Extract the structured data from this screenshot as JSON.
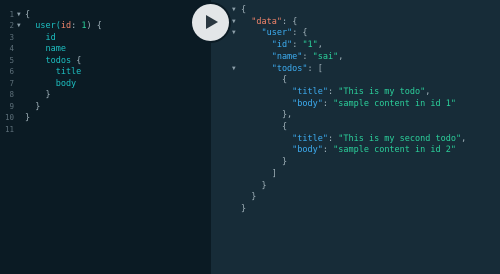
{
  "query_editor": {
    "lines": [
      {
        "num": "1",
        "fold": "▼",
        "parts": [
          {
            "t": "{",
            "c": "punc"
          }
        ]
      },
      {
        "num": "2",
        "fold": "▼",
        "parts": [
          {
            "t": "  user(",
            "c": "field"
          },
          {
            "t": "id",
            "c": "arg"
          },
          {
            "t": ": ",
            "c": "punc"
          },
          {
            "t": "1",
            "c": "num"
          },
          {
            "t": ") {",
            "c": "punc"
          }
        ]
      },
      {
        "num": "3",
        "fold": "",
        "parts": [
          {
            "t": "    id",
            "c": "field"
          }
        ]
      },
      {
        "num": "4",
        "fold": "",
        "parts": [
          {
            "t": "    name",
            "c": "field"
          }
        ]
      },
      {
        "num": "5",
        "fold": "",
        "parts": [
          {
            "t": "    todos ",
            "c": "field"
          },
          {
            "t": "{",
            "c": "punc"
          }
        ]
      },
      {
        "num": "6",
        "fold": "",
        "parts": [
          {
            "t": "      title",
            "c": "field"
          }
        ]
      },
      {
        "num": "7",
        "fold": "",
        "parts": [
          {
            "t": "      body",
            "c": "field"
          }
        ]
      },
      {
        "num": "8",
        "fold": "",
        "parts": [
          {
            "t": "    }",
            "c": "punc"
          }
        ]
      },
      {
        "num": "9",
        "fold": "",
        "parts": [
          {
            "t": "  }",
            "c": "punc"
          }
        ]
      },
      {
        "num": "10",
        "fold": "",
        "parts": [
          {
            "t": "}",
            "c": "punc"
          }
        ]
      },
      {
        "num": "11",
        "fold": "",
        "parts": []
      }
    ]
  },
  "run_button": {
    "icon": "play-icon"
  },
  "result_viewer": {
    "lines": [
      {
        "fold": "▼",
        "parts": [
          {
            "t": "{",
            "c": "punc"
          }
        ]
      },
      {
        "fold": "▼",
        "parts": [
          {
            "t": "  \"data\"",
            "c": "key-top"
          },
          {
            "t": ": {",
            "c": "punc"
          }
        ]
      },
      {
        "fold": "▼",
        "parts": [
          {
            "t": "    \"user\"",
            "c": "key"
          },
          {
            "t": ": {",
            "c": "punc"
          }
        ]
      },
      {
        "fold": "",
        "parts": [
          {
            "t": "      \"id\"",
            "c": "key"
          },
          {
            "t": ": ",
            "c": "punc"
          },
          {
            "t": "\"1\"",
            "c": "str"
          },
          {
            "t": ",",
            "c": "punc"
          }
        ]
      },
      {
        "fold": "",
        "parts": [
          {
            "t": "      \"name\"",
            "c": "key"
          },
          {
            "t": ": ",
            "c": "punc"
          },
          {
            "t": "\"sai\"",
            "c": "str"
          },
          {
            "t": ",",
            "c": "punc"
          }
        ]
      },
      {
        "fold": "▼",
        "parts": [
          {
            "t": "      \"todos\"",
            "c": "key"
          },
          {
            "t": ": [",
            "c": "punc"
          }
        ]
      },
      {
        "fold": "",
        "parts": [
          {
            "t": "        {",
            "c": "punc"
          }
        ]
      },
      {
        "fold": "",
        "parts": [
          {
            "t": "          \"title\"",
            "c": "key"
          },
          {
            "t": ": ",
            "c": "punc"
          },
          {
            "t": "\"This is my todo\"",
            "c": "str"
          },
          {
            "t": ",",
            "c": "punc"
          }
        ]
      },
      {
        "fold": "",
        "parts": [
          {
            "t": "          \"body\"",
            "c": "key"
          },
          {
            "t": ": ",
            "c": "punc"
          },
          {
            "t": "\"sample content in id 1\"",
            "c": "str"
          }
        ]
      },
      {
        "fold": "",
        "parts": [
          {
            "t": "        },",
            "c": "punc"
          }
        ]
      },
      {
        "fold": "",
        "parts": [
          {
            "t": "        {",
            "c": "punc"
          }
        ]
      },
      {
        "fold": "",
        "parts": [
          {
            "t": "          \"title\"",
            "c": "key"
          },
          {
            "t": ": ",
            "c": "punc"
          },
          {
            "t": "\"This is my second todo\"",
            "c": "str"
          },
          {
            "t": ",",
            "c": "punc"
          }
        ]
      },
      {
        "fold": "",
        "parts": [
          {
            "t": "          \"body\"",
            "c": "key"
          },
          {
            "t": ": ",
            "c": "punc"
          },
          {
            "t": "\"sample content in id 2\"",
            "c": "str"
          }
        ]
      },
      {
        "fold": "",
        "parts": [
          {
            "t": "        }",
            "c": "punc"
          }
        ]
      },
      {
        "fold": "",
        "parts": [
          {
            "t": "      ]",
            "c": "punc"
          }
        ]
      },
      {
        "fold": "",
        "parts": [
          {
            "t": "    }",
            "c": "punc"
          }
        ]
      },
      {
        "fold": "",
        "parts": [
          {
            "t": "  }",
            "c": "punc"
          }
        ]
      },
      {
        "fold": "",
        "parts": [
          {
            "t": "}",
            "c": "punc"
          }
        ]
      }
    ]
  },
  "colors": {
    "editor_bg": "#0b1b24",
    "result_bg": "#172c38",
    "field": "#1dbec0",
    "argument": "#f0846a",
    "key": "#3dacf0",
    "string": "#2bcf9a"
  }
}
